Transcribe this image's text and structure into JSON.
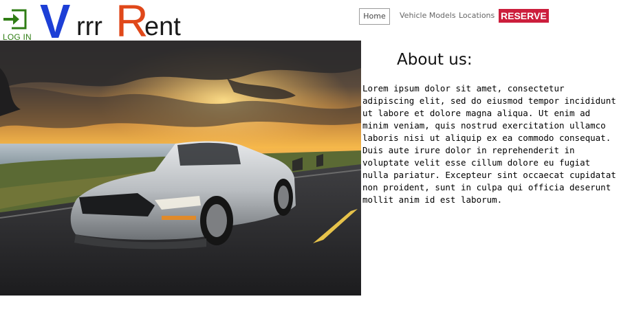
{
  "header": {
    "login_label": "LOG IN",
    "brand": {
      "part1": "V",
      "part2": "rrr",
      "part3": "R",
      "part4": "ent"
    }
  },
  "nav": {
    "items": [
      {
        "label": "Home"
      },
      {
        "label": "Vehicle Models"
      },
      {
        "label": "Locations"
      },
      {
        "label": "RESERVE"
      }
    ]
  },
  "about": {
    "title": "About us:",
    "body": "Lorem ipsum dolor sit amet, consectetur adipiscing elit, sed do eiusmod tempor incididunt ut labore et dolore magna aliqua. Ut enim ad minim veniam, quis nostrud exercitation ullamco laboris nisi ut aliquip ex ea commodo consequat. Duis aute irure dolor in reprehenderit in voluptate velit esse cillum dolore eu fugiat nulla pariatur. Excepteur sint occaecat cupidatat non proident, sunt in culpa qui officia deserunt mollit anim id est laborum."
  },
  "colors": {
    "brand_blue": "#1d3fd6",
    "brand_orange": "#e0481a",
    "login_green": "#2f7d14",
    "reserve_red": "#cc1e3c"
  },
  "icons": {
    "login": "login-enter-icon"
  }
}
